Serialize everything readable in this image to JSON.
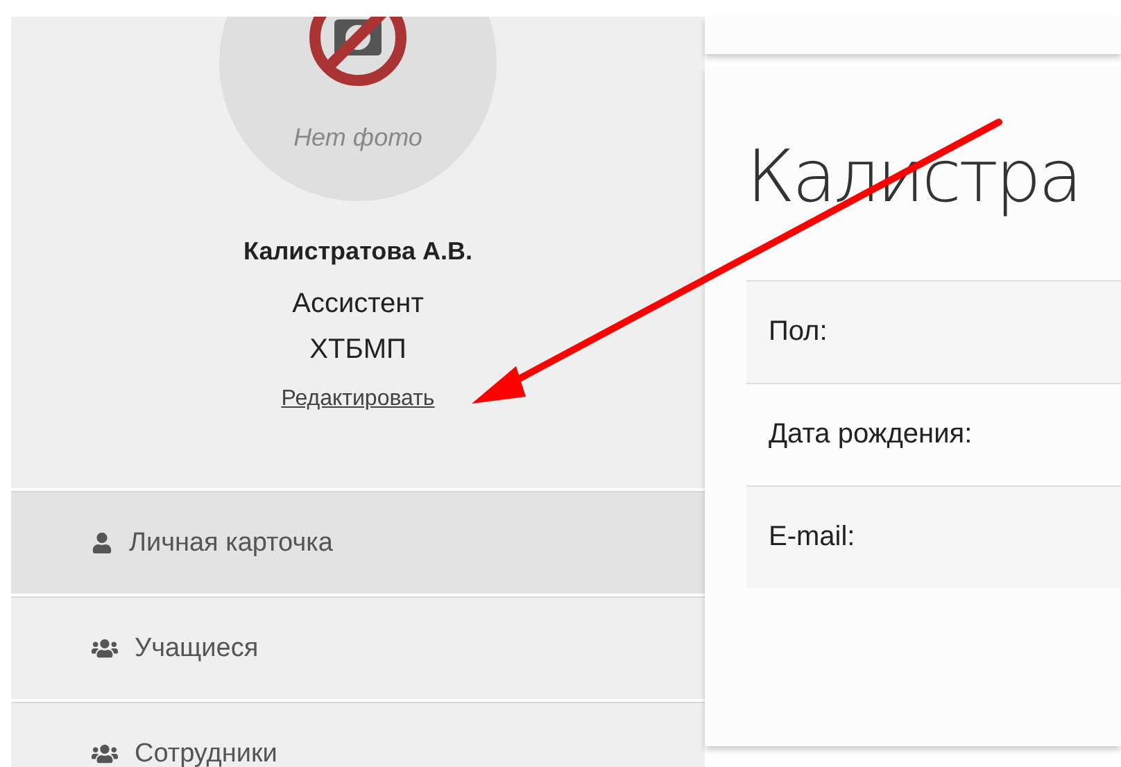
{
  "profile": {
    "no_photo": "Нет фото",
    "name": "Калистратова А.В.",
    "position": "Ассистент",
    "department": "ХТБМП",
    "edit_link": "Редактировать"
  },
  "menu": [
    {
      "label": "Личная карточка",
      "kind": "person",
      "selected": true
    },
    {
      "label": "Учащиеся",
      "kind": "group",
      "selected": false
    },
    {
      "label": "Сотрудники",
      "kind": "group",
      "selected": false
    }
  ],
  "content": {
    "title": "Калистра",
    "fields": [
      {
        "label": "Пол:"
      },
      {
        "label": "Дата рождения:"
      },
      {
        "label": "E-mail:"
      }
    ]
  }
}
